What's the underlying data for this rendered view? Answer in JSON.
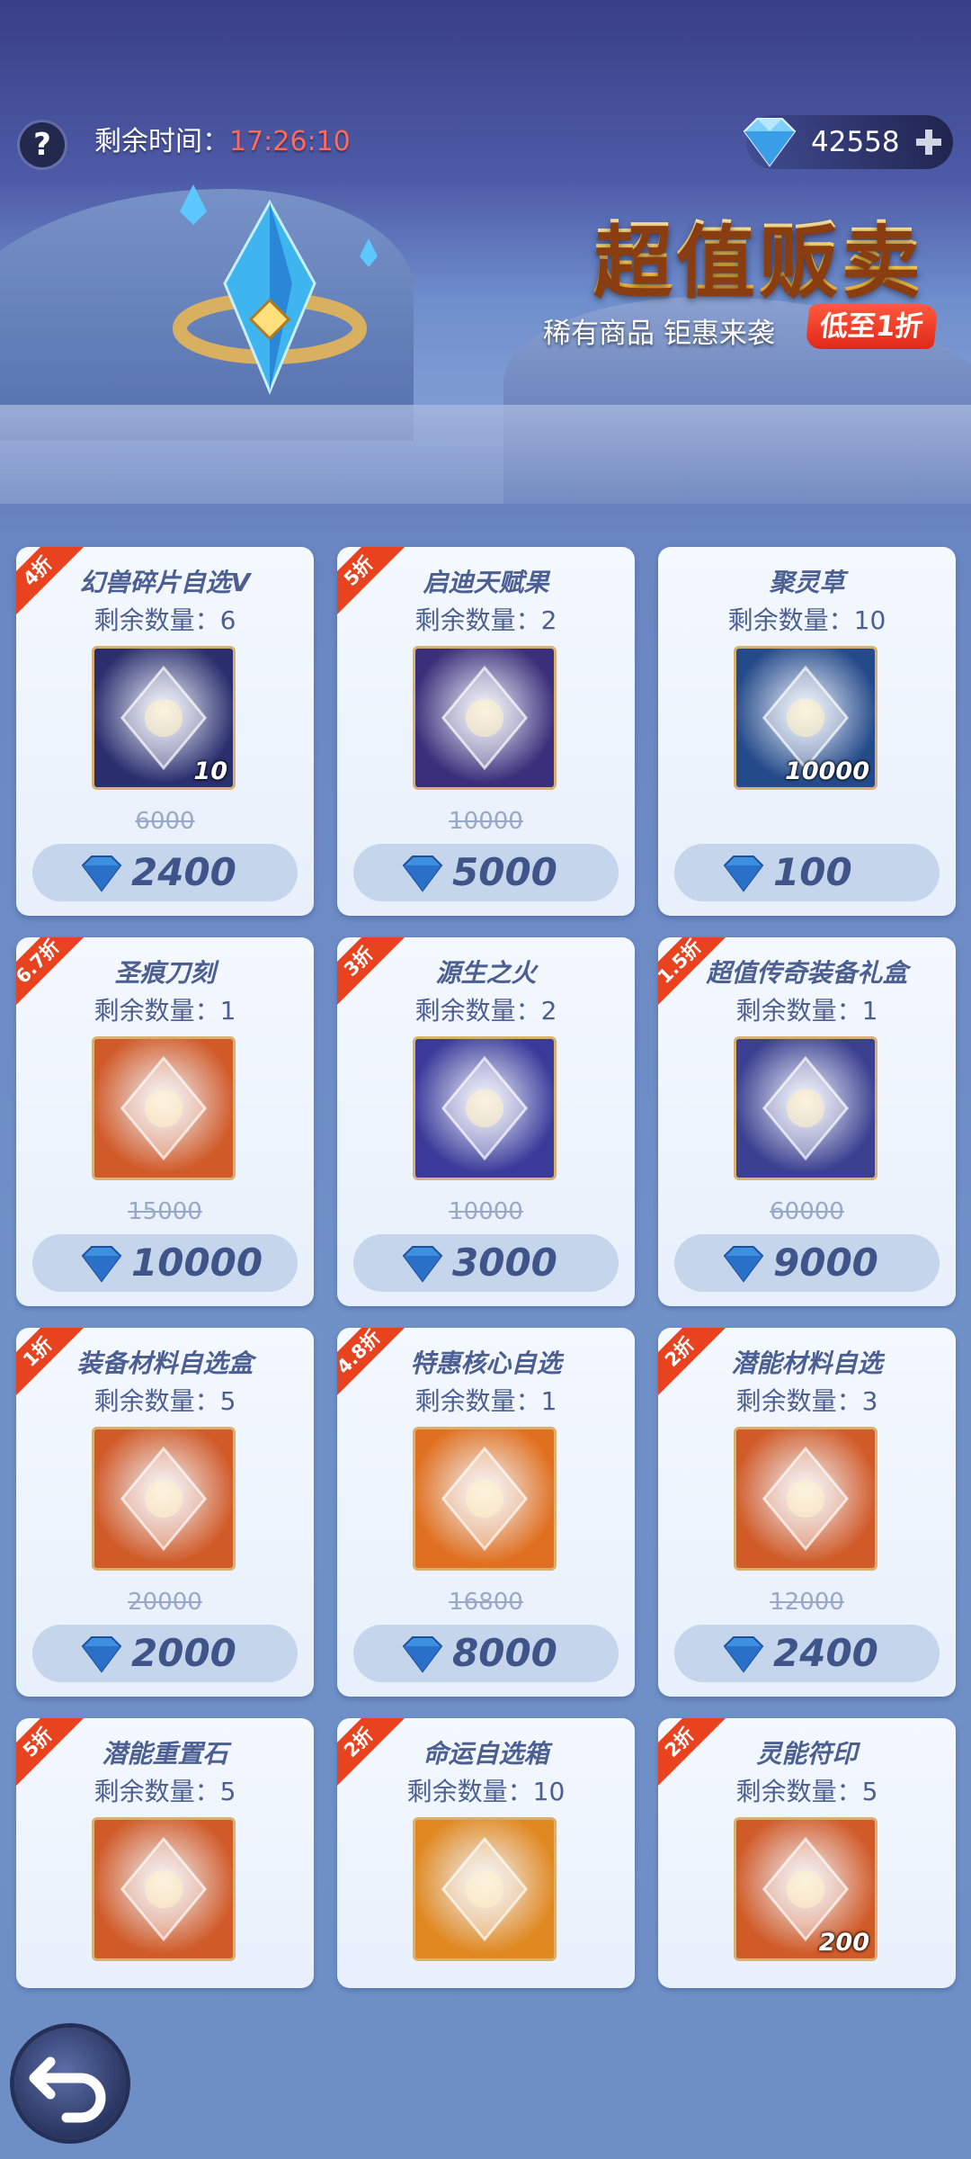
{
  "header": {
    "help_icon": "question-icon",
    "timer_label": "剩余时间：",
    "timer_value": "17:26:10",
    "currency_icon": "diamond-icon",
    "currency_amount": "42558",
    "add_icon": "plus-icon"
  },
  "banner": {
    "title": "超值贩卖",
    "subtitle": "稀有商品 钜惠来袭",
    "badge": "低至1折"
  },
  "items": [
    {
      "discount": "4折",
      "name": "幻兽碎片自选V",
      "remaining": "剩余数量：6",
      "qty": "10",
      "original": "6000",
      "price": "2400",
      "icon": "treasure-chest-icon"
    },
    {
      "discount": "5折",
      "name": "启迪天赋果",
      "remaining": "剩余数量：2",
      "qty": "",
      "original": "10000",
      "price": "5000",
      "icon": "fruit-icon"
    },
    {
      "discount": "",
      "name": "聚灵草",
      "remaining": "剩余数量：10",
      "qty": "10000",
      "original": "",
      "price": "100",
      "icon": "herb-icon"
    },
    {
      "discount": "6.7折",
      "name": "圣痕刀刻",
      "remaining": "剩余数量：1",
      "qty": "",
      "original": "15000",
      "price": "10000",
      "icon": "blade-icon"
    },
    {
      "discount": "3折",
      "name": "源生之火",
      "remaining": "剩余数量：2",
      "qty": "",
      "original": "10000",
      "price": "3000",
      "icon": "fire-orb-icon"
    },
    {
      "discount": "1.5折",
      "name": "超值传奇装备礼盒",
      "remaining": "剩余数量：1",
      "qty": "",
      "original": "60000",
      "price": "9000",
      "icon": "armor-box-icon"
    },
    {
      "discount": "1折",
      "name": "装备材料自选盒",
      "remaining": "剩余数量：5",
      "qty": "",
      "original": "20000",
      "price": "2000",
      "icon": "armor-box-icon"
    },
    {
      "discount": "4.8折",
      "name": "特惠核心自选",
      "remaining": "剩余数量：1",
      "qty": "",
      "original": "16800",
      "price": "8000",
      "icon": "card-icon"
    },
    {
      "discount": "2折",
      "name": "潜能材料自选",
      "remaining": "剩余数量：3",
      "qty": "",
      "original": "12000",
      "price": "2400",
      "icon": "chest-icon"
    },
    {
      "discount": "5折",
      "name": "潜能重置石",
      "remaining": "剩余数量：5",
      "qty": "",
      "original": "",
      "price": "",
      "icon": "crystal-stone-icon"
    },
    {
      "discount": "2折",
      "name": "命运自选箱",
      "remaining": "剩余数量：10",
      "qty": "",
      "original": "",
      "price": "",
      "icon": "gold-chest-icon"
    },
    {
      "discount": "2折",
      "name": "灵能符印",
      "remaining": "剩余数量：5",
      "qty": "200",
      "original": "",
      "price": "",
      "icon": "rune-icon"
    }
  ],
  "footer": {
    "back_icon": "back-arrow-icon"
  },
  "colors": {
    "accent_red": "#e8421f",
    "timer_red": "#ff6a5a",
    "title_gold": "#ffd050",
    "card_bg": "#eef4fc",
    "price_text": "#3f5489"
  }
}
